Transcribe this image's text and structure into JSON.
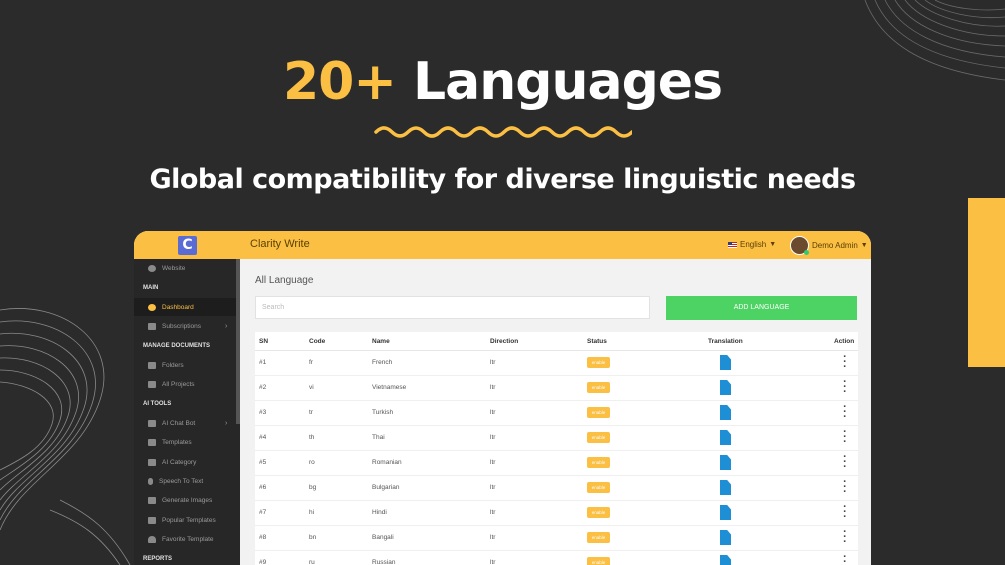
{
  "hero": {
    "accent": "20+",
    "title_rest": "Languages",
    "subtitle": "Global compatibility for diverse linguistic needs"
  },
  "colors": {
    "accent": "#fbbf44",
    "background": "#2b2b2b",
    "button": "#4cd364",
    "doc_icon": "#1e8fd5"
  },
  "app": {
    "brand": "Clarity Write",
    "language": "English",
    "user": "Demo Admin"
  },
  "sidebar": {
    "items": [
      {
        "label": "Website",
        "icon": "globe-icon"
      },
      {
        "label": "MAIN",
        "type": "heading"
      },
      {
        "label": "Dashboard",
        "icon": "dashboard-icon",
        "active": true
      },
      {
        "label": "Subscriptions",
        "icon": "subscription-icon"
      },
      {
        "label": "MANAGE DOCUMENTS",
        "type": "heading"
      },
      {
        "label": "Folders",
        "icon": "folder-icon"
      },
      {
        "label": "All Projects",
        "icon": "projects-icon"
      },
      {
        "label": "AI TOOLS",
        "type": "heading"
      },
      {
        "label": "AI Chat Bot",
        "icon": "chat-icon"
      },
      {
        "label": "Templates",
        "icon": "template-icon"
      },
      {
        "label": "AI Category",
        "icon": "category-icon"
      },
      {
        "label": "Speech To Text",
        "icon": "mic-icon"
      },
      {
        "label": "Generate Images",
        "icon": "image-icon"
      },
      {
        "label": "Popular Templates",
        "icon": "chart-icon"
      },
      {
        "label": "Favorite Template",
        "icon": "heart-icon"
      },
      {
        "label": "REPORTS",
        "type": "heading"
      }
    ]
  },
  "main": {
    "title": "All Language",
    "search_placeholder": "Search",
    "add_button": "ADD LANGUAGE",
    "columns": [
      "SN",
      "Code",
      "Name",
      "Direction",
      "Status",
      "Translation",
      "Action"
    ],
    "rows": [
      {
        "sn": "#1",
        "code": "fr",
        "name": "French",
        "direction": "ltr",
        "status": "enable"
      },
      {
        "sn": "#2",
        "code": "vi",
        "name": "Vietnamese",
        "direction": "ltr",
        "status": "enable"
      },
      {
        "sn": "#3",
        "code": "tr",
        "name": "Turkish",
        "direction": "ltr",
        "status": "enable"
      },
      {
        "sn": "#4",
        "code": "th",
        "name": "Thai",
        "direction": "ltr",
        "status": "enable"
      },
      {
        "sn": "#5",
        "code": "ro",
        "name": "Romanian",
        "direction": "ltr",
        "status": "enable"
      },
      {
        "sn": "#6",
        "code": "bg",
        "name": "Bulgarian",
        "direction": "ltr",
        "status": "enable"
      },
      {
        "sn": "#7",
        "code": "hi",
        "name": "Hindi",
        "direction": "ltr",
        "status": "enable"
      },
      {
        "sn": "#8",
        "code": "bn",
        "name": "Bangali",
        "direction": "ltr",
        "status": "enable"
      },
      {
        "sn": "#9",
        "code": "ru",
        "name": "Russian",
        "direction": "ltr",
        "status": "enable"
      }
    ]
  }
}
